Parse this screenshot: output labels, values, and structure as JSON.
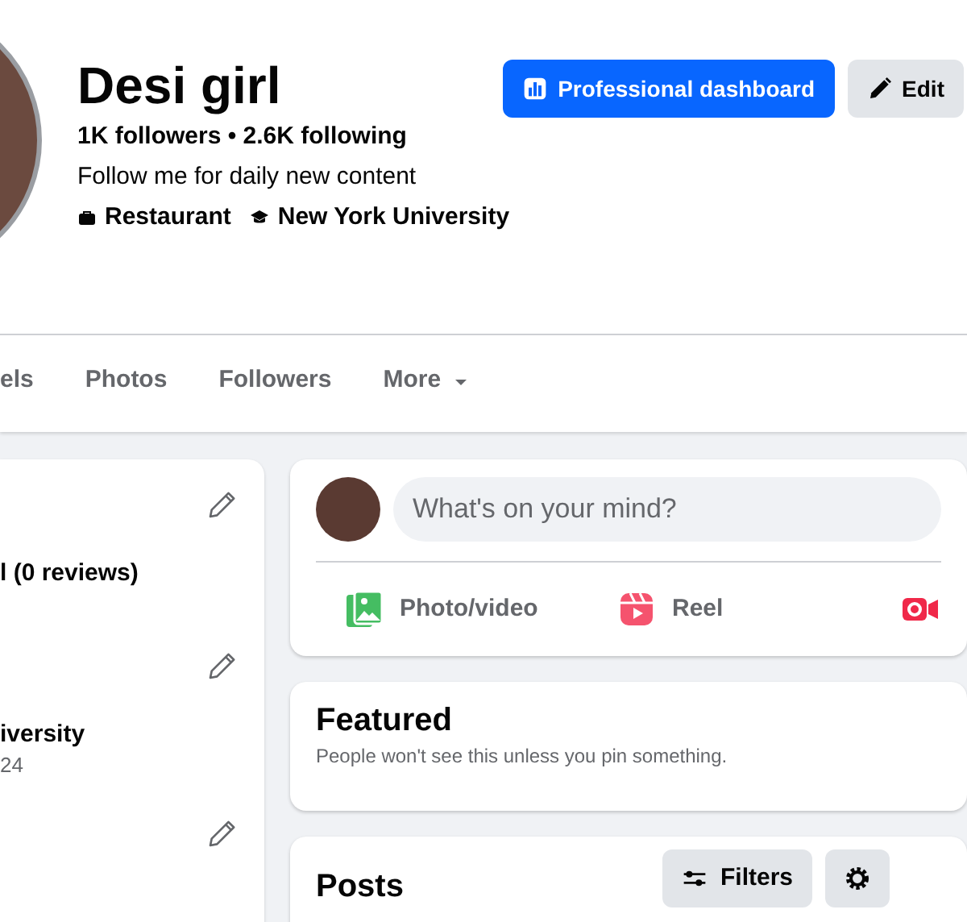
{
  "profile": {
    "name": "Desi girl",
    "stats": "1K followers • 2.6K following",
    "bio": "Follow me for daily new content",
    "details": [
      {
        "kind": "work",
        "label": "Restaurant"
      },
      {
        "kind": "education",
        "label": "New York University"
      }
    ]
  },
  "actions": [
    {
      "kind": "primary",
      "label": "Professional dashboard"
    },
    {
      "kind": "secondary",
      "label": "Edit"
    }
  ],
  "tabs": [
    {
      "label": "els",
      "selected": false
    },
    {
      "label": "Photos",
      "selected": false
    },
    {
      "label": "Followers",
      "selected": false
    },
    {
      "label": "More",
      "selected": false,
      "dropdown": true
    }
  ],
  "intro_card": {
    "sections": [
      {
        "editable": true,
        "text": "l (0 reviews)"
      },
      {
        "editable": true,
        "text": "iversity",
        "subtext": "24"
      },
      {
        "editable": true
      }
    ]
  },
  "composer": {
    "placeholder": "What's on your mind?",
    "actions": [
      {
        "kind": "photo",
        "label": "Photo/video"
      },
      {
        "kind": "reel",
        "label": "Reel"
      },
      {
        "kind": "live"
      }
    ]
  },
  "featured": {
    "title": "Featured",
    "description": "People won't see this unless you pin something."
  },
  "posts": {
    "title": "Posts",
    "buttons": [
      {
        "kind": "filters",
        "label": "Filters"
      },
      {
        "kind": "manage"
      }
    ]
  }
}
